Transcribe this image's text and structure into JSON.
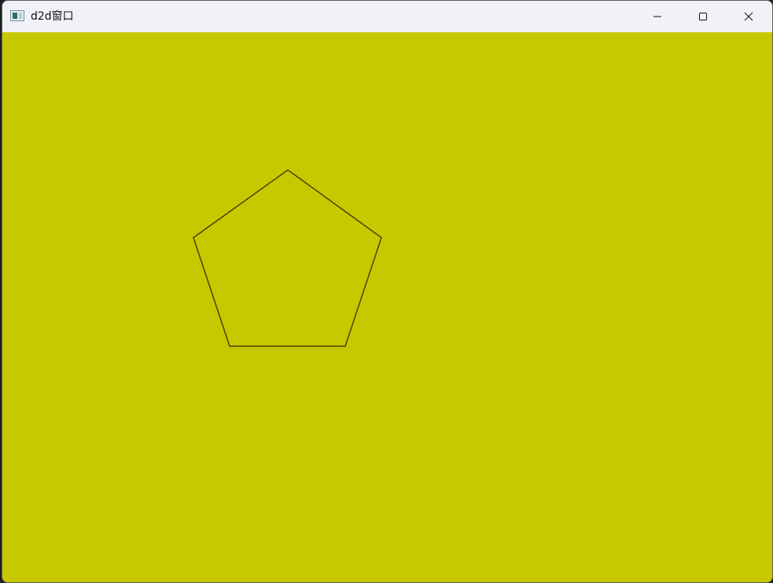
{
  "window": {
    "title": "d2d窗口",
    "background_color": "#c8c800",
    "titlebar_color": "#f0f2f7"
  },
  "title_bar_buttons": [
    {
      "name": "minimize",
      "icon": "minimize-icon"
    },
    {
      "name": "maximize",
      "icon": "maximize-icon"
    },
    {
      "name": "close",
      "icon": "close-icon"
    }
  ],
  "canvas": {
    "shape": "pentagon",
    "stroke_color": "#4a4300",
    "fill": "none"
  }
}
